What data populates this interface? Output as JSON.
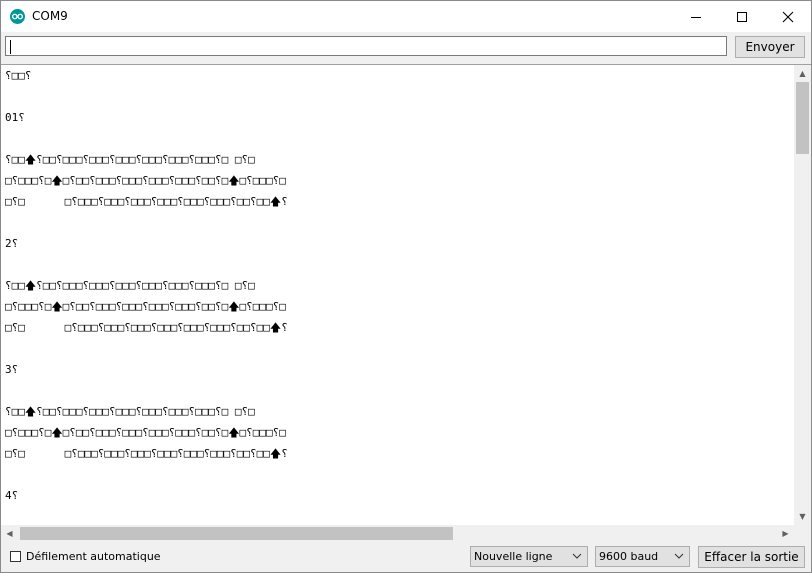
{
  "window": {
    "title": "COM9"
  },
  "send": {
    "input_value": "",
    "button_label": "Envoyer"
  },
  "output": {
    "lines": [
      "⸮□□⸮",
      "",
      "01⸮",
      "",
      "⸮□□🡅⸮□□⸮□□□⸮□□□⸮□□□⸮□□□⸮□□□⸮□□□⸮□ □⸮□",
      "□⸮□□□⸮□🡅□⸮□□⸮□□□⸮□□□⸮□□□⸮□□□⸮□□⸮□🡅□⸮□□□⸮□",
      "□⸮□      □⸮□□□⸮□□□⸮□□□⸮□□□⸮□□□⸮□□□⸮□□⸮□□🡅⸮",
      "",
      "2⸮",
      "",
      "⸮□□🡅⸮□□⸮□□□⸮□□□⸮□□□⸮□□□⸮□□□⸮□□□⸮□ □⸮□",
      "□⸮□□□⸮□🡅□⸮□□⸮□□□⸮□□□⸮□□□⸮□□□⸮□□⸮□🡅□⸮□□□⸮□",
      "□⸮□      □⸮□□□⸮□□□⸮□□□⸮□□□⸮□□□⸮□□□⸮□□⸮□□🡅⸮",
      "",
      "3⸮",
      "",
      "⸮□□🡅⸮□□⸮□□□⸮□□□⸮□□□⸮□□□⸮□□□⸮□□□⸮□ □⸮□",
      "□⸮□□□⸮□🡅□⸮□□⸮□□□⸮□□□⸮□□□⸮□□□⸮□□⸮□🡅□⸮□□□⸮□",
      "□⸮□      □⸮□□□⸮□□□⸮□□□⸮□□□⸮□□□⸮□□□⸮□□⸮□□🡅⸮",
      "",
      "4⸮",
      "",
      ""
    ]
  },
  "status": {
    "autoscroll_label": "Défilement automatique",
    "autoscroll_checked": false,
    "line_ending": "Nouvelle ligne",
    "baud": "9600 baud",
    "clear_label": "Effacer la sortie"
  },
  "colors": {
    "app_icon": "#00979c",
    "button_bg": "#e1e1e1"
  }
}
